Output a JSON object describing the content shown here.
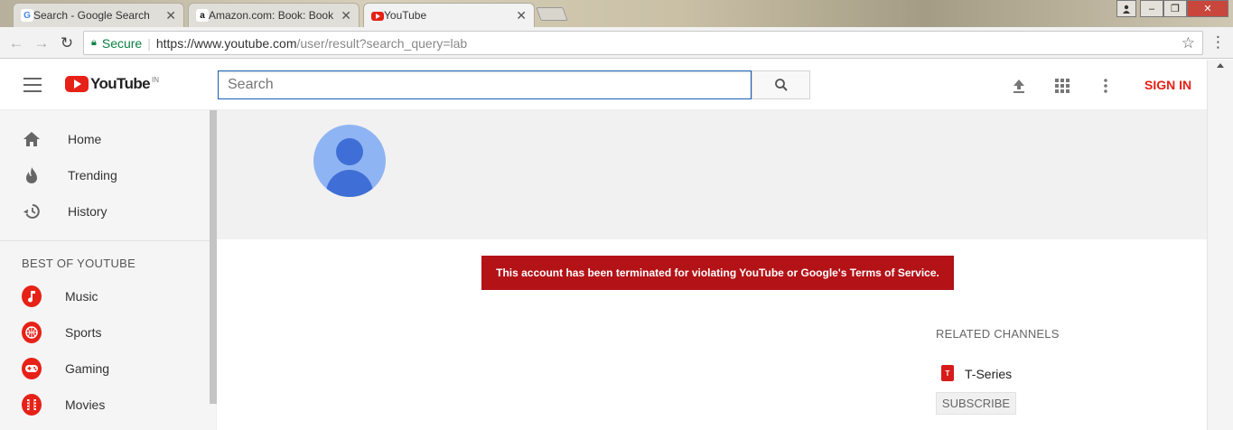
{
  "browser": {
    "tabs": [
      {
        "title": "Search - Google Search",
        "icon": "google-icon"
      },
      {
        "title": "Amazon.com: Book: Book",
        "icon": "amazon-icon"
      },
      {
        "title": "YouTube",
        "icon": "youtube-icon"
      }
    ],
    "address": {
      "secure_label": "Secure",
      "url_host": "https://www.youtube.com",
      "url_path": "/user/result?search_query=lab"
    }
  },
  "header": {
    "logo_text": "YouTube",
    "country_code": "IN",
    "search_placeholder": "Search",
    "signin_label": "SIGN IN"
  },
  "sidebar": {
    "items": [
      {
        "label": "Home",
        "icon": "home-icon"
      },
      {
        "label": "Trending",
        "icon": "flame-icon"
      },
      {
        "label": "History",
        "icon": "history-icon"
      }
    ],
    "section_title": "BEST OF YOUTUBE",
    "best_of": [
      {
        "label": "Music",
        "icon": "music-icon"
      },
      {
        "label": "Sports",
        "icon": "sports-icon"
      },
      {
        "label": "Gaming",
        "icon": "gaming-icon"
      },
      {
        "label": "Movies",
        "icon": "movies-icon"
      }
    ]
  },
  "main": {
    "terminated_message": "This account has been terminated for violating YouTube or Google's Terms of Service.",
    "related_title": "RELATED CHANNELS",
    "related_channels": [
      {
        "name": "T-Series",
        "subscribe_label": "SUBSCRIBE"
      }
    ]
  },
  "colors": {
    "brand_red": "#e62117",
    "banner_red": "#b31217",
    "secure_green": "#0b8043",
    "search_focus": "#1c62b9"
  }
}
